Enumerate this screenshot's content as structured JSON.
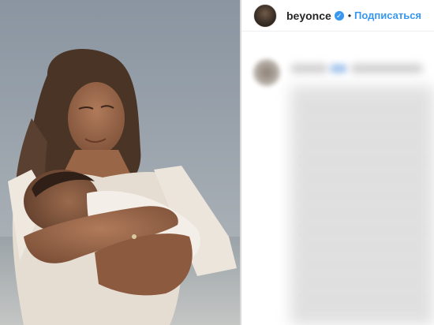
{
  "header": {
    "username": "beyonce",
    "separator": "•",
    "follow_label": "Подписаться"
  },
  "icons": {
    "verified": "verified-badge-icon",
    "avatar": "profile-avatar"
  },
  "colors": {
    "accent": "#3897f0",
    "text": "#262626",
    "border": "#efefef"
  }
}
